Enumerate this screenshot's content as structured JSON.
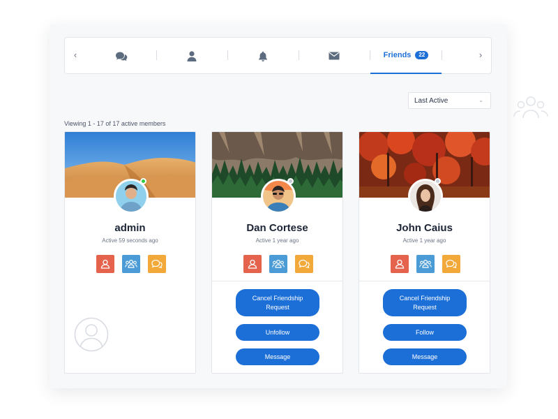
{
  "tabs": {
    "prev_arrow": "‹",
    "next_arrow": "›",
    "items": [
      {
        "icon": "chat-icon"
      },
      {
        "icon": "user-icon"
      },
      {
        "icon": "bell-icon"
      },
      {
        "icon": "envelope-icon"
      },
      {
        "label": "Friends",
        "count": "22",
        "active": true
      }
    ]
  },
  "sort": {
    "selected": "Last Active"
  },
  "viewing_text": "Viewing 1 - 17 of 17 active members",
  "colors": {
    "accent": "#1d6fd8",
    "online": "#2ecc40",
    "offline": "#c7ccd3"
  },
  "members": [
    {
      "name": "admin",
      "active": "Active 59 seconds ago",
      "online": true,
      "cover": "desert",
      "buttons": []
    },
    {
      "name": "Dan Cortese",
      "active": "Active 1 year ago",
      "online": false,
      "cover": "forest",
      "buttons": [
        "Cancel Friendship Request",
        "Unfollow",
        "Message"
      ]
    },
    {
      "name": "John Caius",
      "active": "Active 1 year ago",
      "online": false,
      "cover": "autumn",
      "buttons": [
        "Cancel Friendship Request",
        "Follow",
        "Message"
      ]
    }
  ]
}
